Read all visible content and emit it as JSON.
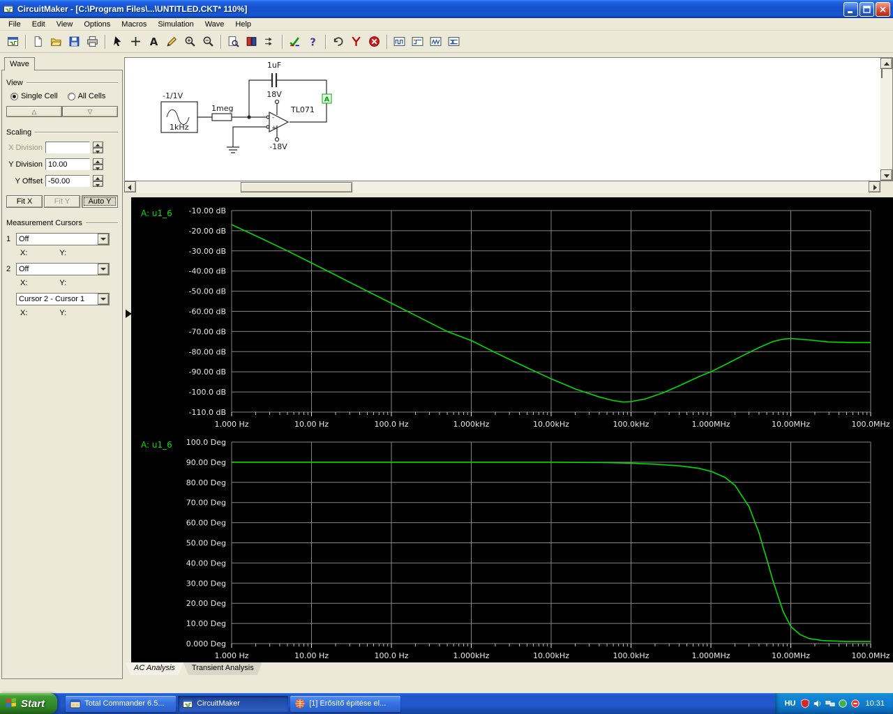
{
  "window": {
    "title": "CircuitMaker - [C:\\Program Files\\...\\UNTITLED.CKT* 110%]"
  },
  "menu": {
    "items": [
      "File",
      "Edit",
      "View",
      "Options",
      "Macros",
      "Simulation",
      "Wave",
      "Help"
    ]
  },
  "toolbar": {
    "buttons": [
      "circuit-window",
      "sep",
      "new-file",
      "open-folder",
      "save",
      "print",
      "sep",
      "cursor-arrow",
      "plus-tool",
      "text-tool",
      "wire-pencil",
      "zoom-glass",
      "probe-glass",
      "sep",
      "find-part",
      "library-book",
      "compare-arrows",
      "sep",
      "run-check",
      "help-question",
      "sep",
      "undo-arrow",
      "probe-y",
      "stop-circle",
      "sep",
      "wave-digital",
      "wave-step",
      "wave-pulse",
      "wave-bus"
    ]
  },
  "left_panel": {
    "tab_label": "Wave",
    "view": {
      "group_label": "View",
      "single_cell_label": "Single Cell",
      "all_cells_label": "All Cells",
      "selected": "Single Cell",
      "up_icon": "△",
      "down_icon": "▽"
    },
    "scaling": {
      "group_label": "Scaling",
      "x_division_label": "X Division",
      "x_division_value": "",
      "y_division_label": "Y Division",
      "y_division_value": "10.00",
      "y_offset_label": "Y Offset",
      "y_offset_value": "-50.00",
      "fit_x_label": "Fit X",
      "fit_y_label": "Fit Y",
      "auto_y_label": "Auto Y"
    },
    "cursors": {
      "group_label": "Measurement Cursors",
      "cursor1_label": "1",
      "cursor1_value": "Off",
      "cursor2_label": "2",
      "cursor2_value": "Off",
      "diff_value": "Cursor 2 - Cursor 1",
      "x_label": "X:",
      "y_label": "Y:"
    }
  },
  "schematic": {
    "capacitor_label": "1uF",
    "vplus_label": "18V",
    "vminus_label": "-18V",
    "opamp_label": "TL071",
    "source_amplitude_label": "-1/1V",
    "source_frequency_label": "1kHz",
    "resistor_label": "1meg",
    "probe_label": "A"
  },
  "chart_data": [
    {
      "type": "line",
      "legend": "A: u1_6",
      "x_scale": "log",
      "xlim": [
        1,
        100000000
      ],
      "ylim": [
        -110,
        -10
      ],
      "x_ticks": [
        "1.000 Hz",
        "10.00 Hz",
        "100.0 Hz",
        "1.000kHz",
        "10.00kHz",
        "100.0kHz",
        "1.000MHz",
        "10.00MHz",
        "100.0MHz"
      ],
      "y_ticks": [
        "-10.00 dB",
        "-20.00 dB",
        "-30.00 dB",
        "-40.00 dB",
        "-50.00 dB",
        "-60.00 dB",
        "-70.00 dB",
        "-80.00 dB",
        "-90.00 dB",
        "-100.0 dB",
        "-110.0 dB"
      ],
      "grid": true,
      "legend_position": "top-left",
      "colors": {
        "background": "#000000",
        "grid": "#878787",
        "text": "#e8e8e8",
        "line": "#00dc00"
      },
      "series": [
        {
          "name": "u1_6",
          "x": [
            1,
            2,
            5,
            10,
            20,
            50,
            100,
            200,
            500,
            1000,
            2000,
            5000,
            10000,
            20000,
            40000,
            60000,
            80000,
            100000,
            150000,
            250000,
            400000,
            700000,
            1000000,
            1500000,
            2500000,
            4000000,
            6000000,
            8000000,
            10000000,
            15000000,
            30000000,
            60000000,
            100000000
          ],
          "y": [
            -17,
            -22.5,
            -30,
            -36,
            -42,
            -50,
            -56,
            -62,
            -70,
            -74.5,
            -80.5,
            -88,
            -93.5,
            -98.5,
            -102.5,
            -104.3,
            -105,
            -104.8,
            -103.5,
            -100.5,
            -97,
            -92.5,
            -90,
            -86.5,
            -82,
            -78,
            -75,
            -73.8,
            -73.5,
            -74,
            -75.2,
            -75.5,
            -75.5
          ]
        }
      ]
    },
    {
      "type": "line",
      "legend": "A: u1_6",
      "x_scale": "log",
      "xlim": [
        1,
        100000000
      ],
      "ylim": [
        0,
        100
      ],
      "x_ticks": [
        "1.000 Hz",
        "10.00 Hz",
        "100.0 Hz",
        "1.000kHz",
        "10.00kHz",
        "100.0kHz",
        "1.000MHz",
        "10.00MHz",
        "100.0MHz"
      ],
      "y_ticks": [
        "100.0 Deg",
        "90.00 Deg",
        "80.00 Deg",
        "70.00 Deg",
        "60.00 Deg",
        "50.00 Deg",
        "40.00 Deg",
        "30.00 Deg",
        "20.00 Deg",
        "10.00 Deg",
        "0.000 Deg"
      ],
      "grid": true,
      "legend_position": "top-left",
      "colors": {
        "background": "#000000",
        "grid": "#878787",
        "text": "#e8e8e8",
        "line": "#00dc00"
      },
      "series": [
        {
          "name": "u1_6",
          "x": [
            1,
            10,
            100,
            1000,
            10000,
            50000,
            100000,
            200000,
            400000,
            700000,
            1000000,
            1500000,
            2000000,
            3000000,
            4000000,
            5000000,
            6000000,
            8000000,
            10000000,
            13000000,
            17000000,
            25000000,
            50000000,
            100000000
          ],
          "y": [
            90,
            90,
            90,
            90,
            90,
            89.8,
            89.5,
            89,
            88.2,
            87,
            85.5,
            82.5,
            78.5,
            68,
            55,
            42,
            31,
            16,
            8.5,
            4.5,
            2.5,
            1.5,
            1,
            1
          ]
        }
      ]
    }
  ],
  "analysis_tabs": {
    "tabs": [
      "AC Analysis",
      "Transient Analysis"
    ],
    "selected": "AC Analysis"
  },
  "taskbar": {
    "start_label": "Start",
    "tasks": [
      {
        "label": "Total Commander 6.5...",
        "icon": "total-commander",
        "active": false
      },
      {
        "label": "CircuitMaker",
        "icon": "circuit-window",
        "active": true
      },
      {
        "label": "[1] Erősítő építése el...",
        "icon": "browser-globe",
        "active": false
      }
    ],
    "tray": {
      "language": "HU",
      "icons": [
        "tray-shield",
        "tray-volume",
        "tray-network",
        "tray-green",
        "tray-red"
      ],
      "clock": "10:31"
    }
  }
}
